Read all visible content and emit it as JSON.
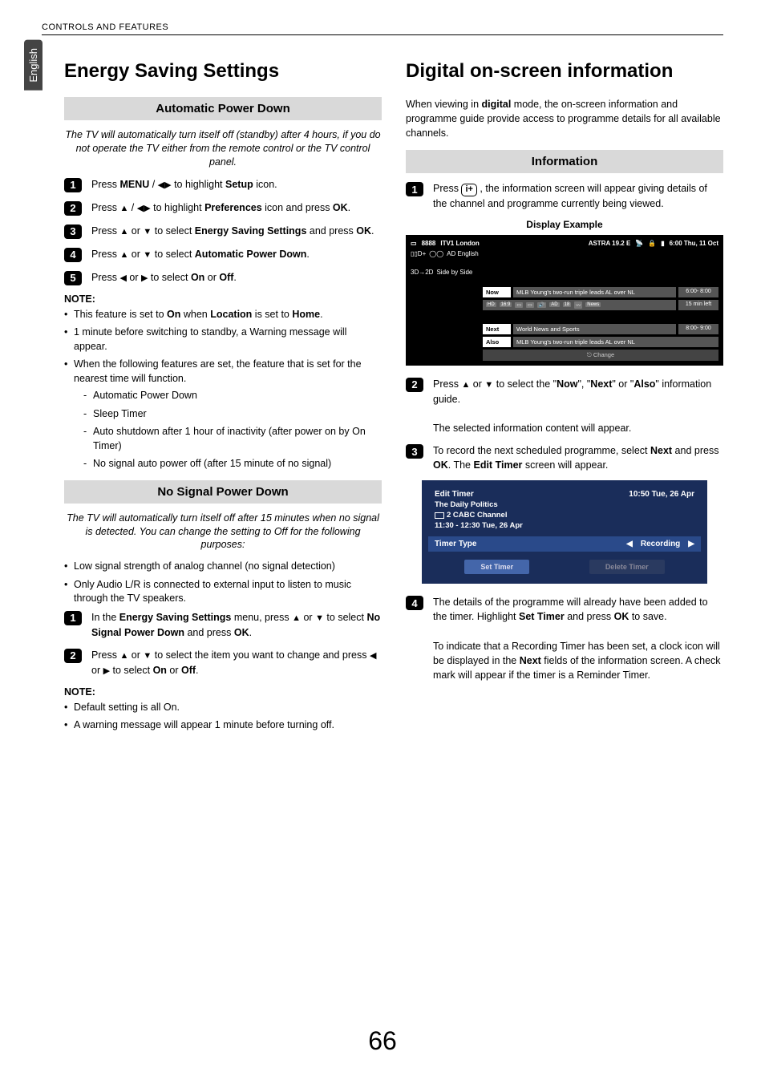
{
  "header": {
    "section": "CONTROLS AND FEATURES"
  },
  "language_tab": "English",
  "page_number": "66",
  "left": {
    "title": "Energy Saving Settings",
    "auto_power_down": {
      "heading": "Automatic Power Down",
      "intro": "The TV will automatically turn itself off (standby) after 4 hours, if you do not operate the TV either from the remote control or the TV control panel.",
      "steps": {
        "1_prefix": "Press ",
        "1_menu": "MENU",
        "1_mid": " / ",
        "1_arrows": "◀▶",
        "1_mid2": " to highlight ",
        "1_setup": "Setup",
        "1_suffix": " icon.",
        "2_prefix": "Press ",
        "2_up": "▲",
        "2_mid": " / ",
        "2_arrows": "◀▶",
        "2_mid2": " to highlight ",
        "2_pref": "Preferences",
        "2_mid3": " icon and press ",
        "2_ok": "OK",
        "2_suffix": ".",
        "3_prefix": "Press ",
        "3_up": "▲",
        "3_or": " or ",
        "3_down": "▼",
        "3_mid": " to select ",
        "3_ess": "Energy Saving Settings",
        "3_mid2": " and press ",
        "3_ok": "OK",
        "3_suffix": ".",
        "4_prefix": "Press ",
        "4_up": "▲",
        "4_or": " or ",
        "4_down": "▼",
        "4_mid": " to select ",
        "4_apd": "Automatic Power Down",
        "4_suffix": ".",
        "5_prefix": "Press ",
        "5_left": "◀",
        "5_or": " or ",
        "5_right": "▶",
        "5_mid": " to select ",
        "5_on": "On",
        "5_or2": " or ",
        "5_off": "Off",
        "5_suffix": "."
      },
      "note_label": "NOTE:",
      "notes": {
        "a_pre": "This feature is set to ",
        "a_on": "On",
        "a_mid": " when ",
        "a_loc": "Location",
        "a_mid2": " is set to ",
        "a_home": "Home",
        "a_suf": ".",
        "b": "1 minute before switching to standby, a Warning message will appear.",
        "c": "When the following features are set, the feature that is set for the nearest time will function.",
        "c_sub": [
          "Automatic Power Down",
          "Sleep Timer",
          "Auto shutdown after 1 hour of inactivity (after power on by On Timer)",
          "No signal auto power off (after 15 minute of no signal)"
        ]
      }
    },
    "no_signal": {
      "heading": "No Signal Power Down",
      "intro": "The TV will automatically turn itself off after 15 minutes when no signal is detected. You can change the setting to Off for the following purposes:",
      "bullets": [
        "Low signal strength of analog channel (no signal detection)",
        "Only Audio L/R is connected to external input to listen to music through the TV speakers."
      ],
      "steps": {
        "1_pre": "In the ",
        "1_ess": "Energy Saving Settings",
        "1_mid": " menu, press ",
        "1_up": "▲",
        "1_or": " or ",
        "1_down": "▼",
        "1_mid2": " to select ",
        "1_nspd": "No Signal Power Down",
        "1_mid3": " and press ",
        "1_ok": "OK",
        "1_suf": ".",
        "2_pre": "Press ",
        "2_up": "▲",
        "2_or": " or ",
        "2_down": "▼",
        "2_mid": " to select the item you want to change and press ",
        "2_left": "◀",
        "2_or2": " or ",
        "2_right": "▶",
        "2_mid2": " to select ",
        "2_on": "On",
        "2_or3": " or ",
        "2_off": "Off",
        "2_suf": "."
      },
      "note_label": "NOTE:",
      "notes": [
        "Default setting is all On.",
        "A warning message will appear 1 minute before turning off."
      ]
    }
  },
  "right": {
    "title": "Digital on-screen information",
    "intro_pre": "When viewing in ",
    "intro_digital": "digital",
    "intro_post": " mode, the on-screen information and programme guide provide access to programme details for all available channels.",
    "information": {
      "heading": "Information",
      "step1_pre": "Press ",
      "step1_btn": "i+",
      "step1_post": " , the information screen will appear giving details of the channel and programme currently being viewed.",
      "display_example": "Display Example",
      "info_box": {
        "ch_num": "8888",
        "ch_name": "ITV1 London",
        "sat": "ASTRA 19.2 E",
        "datetime": "6:00 Thu, 11 Oct",
        "audio_tag": "AD English",
        "three_d": "3D→2D",
        "side": "Side by Side",
        "now": "Now",
        "now_prog": "MLB Young's two-run triple leads AL over NL",
        "now_time": "6:00- 8:00",
        "badges": [
          "HD",
          "16:9",
          "AD",
          "18",
          "News"
        ],
        "time_left": "15 min left",
        "next": "Next",
        "next_prog": "World News and Sports",
        "next_time": "8:00- 9:00",
        "also": "Also",
        "also_prog": "MLB Young's two-run triple leads AL over NL",
        "change": "Change"
      },
      "step2_pre": "Press ",
      "step2_up": "▲",
      "step2_or": " or ",
      "step2_down": "▼",
      "step2_mid": " to select the \"",
      "step2_now": "Now",
      "step2_q1": "\", \"",
      "step2_next": "Next",
      "step2_q2": "\" or \"",
      "step2_also": "Also",
      "step2_suf": "\" information guide.",
      "step2_p2": "The selected information content will appear.",
      "step3_pre": "To record the next scheduled programme, select ",
      "step3_next": "Next",
      "step3_mid": " and press ",
      "step3_ok": "OK",
      "step3_mid2": ". The ",
      "step3_et": "Edit Timer",
      "step3_suf": " screen will appear.",
      "timer_box": {
        "title": "Edit Timer",
        "clock": "10:50 Tue, 26 Apr",
        "prog": "The Daily Politics",
        "channel": "2 CABC Channel",
        "timeslot": "11:30 - 12:30 Tue, 26 Apr",
        "row_label": "Timer Type",
        "row_value": "Recording",
        "btn_set": "Set Timer",
        "btn_del": "Delete Timer"
      },
      "step4_pre": "The details of the programme will already have been added to the timer. Highlight ",
      "step4_set": "Set Timer",
      "step4_mid": " and press ",
      "step4_ok": "OK",
      "step4_suf": " to save.",
      "step4_p2_pre": "To indicate that a Recording Timer has been set, a clock icon will be displayed in the ",
      "step4_p2_next": "Next",
      "step4_p2_suf": " fields of the information screen. A check mark will appear if the timer is a Reminder Timer."
    }
  }
}
